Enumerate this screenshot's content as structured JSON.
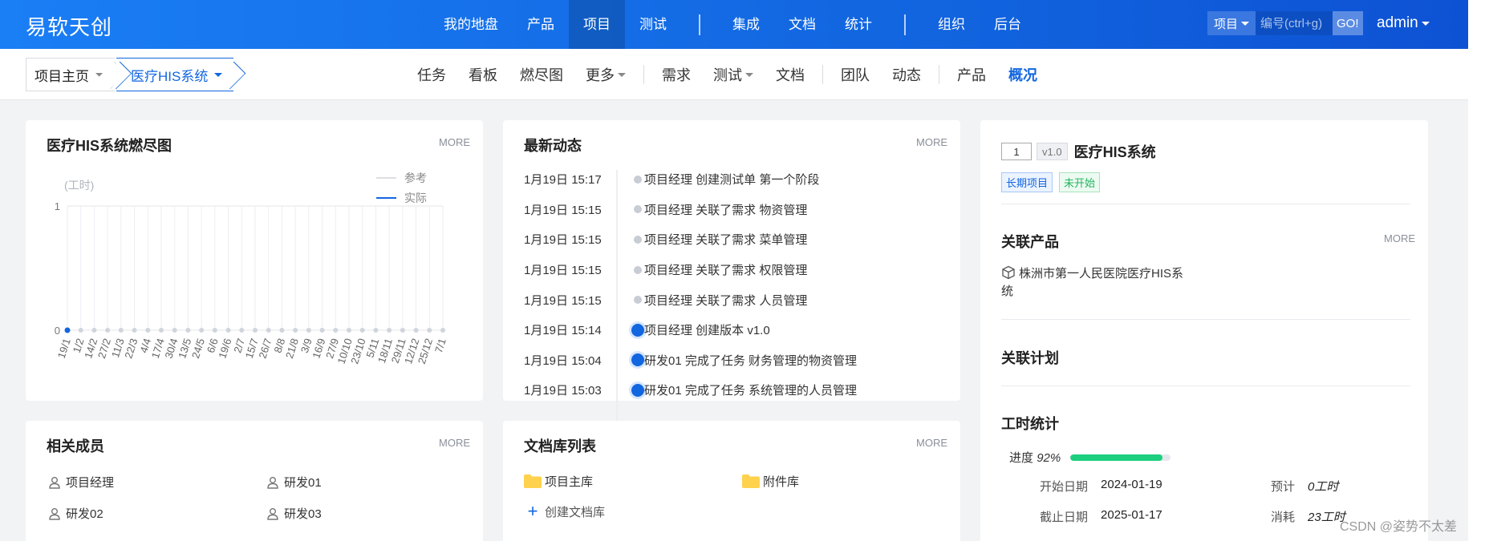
{
  "brand": "易软天创",
  "topnav": [
    "我的地盘",
    "产品",
    "项目",
    "测试",
    "集成",
    "文档",
    "统计",
    "组织",
    "后台"
  ],
  "topnav_active": "项目",
  "search": {
    "type": "项目",
    "placeholder": "编号(ctrl+g)",
    "go": "GO!"
  },
  "user": "admin",
  "breadcrumb": {
    "home": "项目主页",
    "project": "医疗HIS系统"
  },
  "subnav": [
    "任务",
    "看板",
    "燃尽图",
    "更多",
    "需求",
    "测试",
    "文档",
    "团队",
    "动态",
    "产品",
    "概况"
  ],
  "subnav_active": "概况",
  "more_label": "MORE",
  "burndown": {
    "title": "医疗HIS系统燃尽图",
    "chart_data": {
      "type": "line",
      "ylabel": "(工时)",
      "ylim": [
        0,
        1
      ],
      "yticks": [
        "1",
        "0"
      ],
      "x": [
        "19/1",
        "1/2",
        "14/2",
        "27/2",
        "11/3",
        "22/3",
        "4/4",
        "17/4",
        "30/4",
        "13/5",
        "24/5",
        "6/6",
        "19/6",
        "2/7",
        "15/7",
        "26/7",
        "8/8",
        "21/8",
        "3/9",
        "16/9",
        "27/9",
        "10/10",
        "23/10",
        "5/11",
        "18/11",
        "29/11",
        "12/12",
        "25/12",
        "7/1"
      ],
      "series": [
        {
          "name": "参考",
          "values": [
            0,
            0,
            0,
            0,
            0,
            0,
            0,
            0,
            0,
            0,
            0,
            0,
            0,
            0,
            0,
            0,
            0,
            0,
            0,
            0,
            0,
            0,
            0,
            0,
            0,
            0,
            0,
            0,
            0
          ],
          "color": "#d0d4dc"
        },
        {
          "name": "实际",
          "values": [
            0
          ],
          "color": "#1266e0"
        }
      ],
      "legend": "top-right",
      "grid": true
    }
  },
  "dynamics": {
    "title": "最新动态",
    "items": [
      {
        "time": "1月19日 15:17",
        "text": "项目经理 创建测试单 第一个阶段",
        "hl": false
      },
      {
        "time": "1月19日 15:15",
        "text": "项目经理 关联了需求 物资管理",
        "hl": false
      },
      {
        "time": "1月19日 15:15",
        "text": "项目经理 关联了需求 菜单管理",
        "hl": false
      },
      {
        "time": "1月19日 15:15",
        "text": "项目经理 关联了需求 权限管理",
        "hl": false
      },
      {
        "time": "1月19日 15:15",
        "text": "项目经理 关联了需求 人员管理",
        "hl": false
      },
      {
        "time": "1月19日 15:14",
        "text": "项目经理 创建版本 v1.0",
        "hl": true
      },
      {
        "time": "1月19日 15:04",
        "text": "研发01 完成了任务 财务管理的物资管理",
        "hl": true
      },
      {
        "time": "1月19日 15:03",
        "text": "研发01 完成了任务 系统管理的人员管理",
        "hl": true
      }
    ]
  },
  "project": {
    "id": "1",
    "version": "v1.0",
    "name": "医疗HIS系统",
    "tags": [
      "长期项目",
      "未开始"
    ],
    "related_product_title": "关联产品",
    "related_product": "株洲市第一人民医院医疗HIS系统",
    "related_plan_title": "关联计划",
    "hours_title": "工时统计",
    "progress_label": "进度",
    "progress_value": "92%",
    "progress_fraction": 0.92,
    "start_label": "开始日期",
    "start": "2024-01-19",
    "end_label": "截止日期",
    "end": "2025-01-17",
    "estimate_label": "预计",
    "estimate": "0工时",
    "consumed_label": "消耗",
    "consumed": "23工时"
  },
  "members": {
    "title": "相关成员",
    "items": [
      "项目经理",
      "研发01",
      "研发02",
      "研发03"
    ]
  },
  "doclib": {
    "title": "文档库列表",
    "items": [
      "项目主库",
      "附件库"
    ],
    "create": "创建文档库"
  },
  "watermark": "CSDN @姿势不太差",
  "colors": {
    "primary": "#1266e0",
    "success": "#1ccf7f"
  }
}
